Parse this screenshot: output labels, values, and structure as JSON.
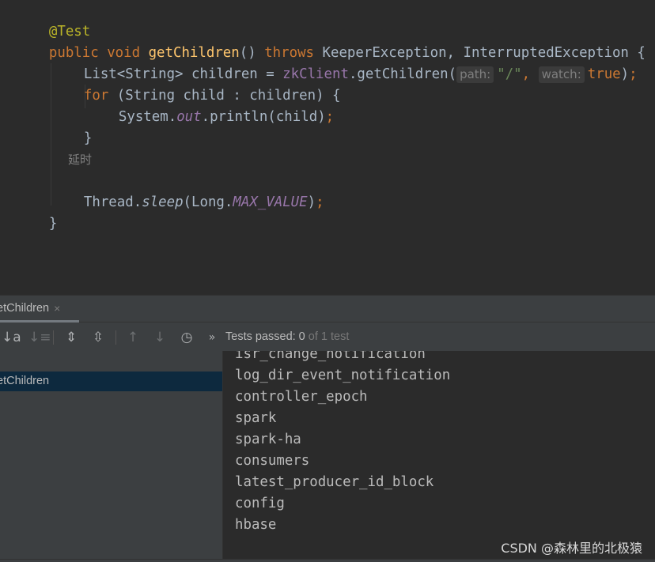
{
  "editor": {
    "annotation": "@Test",
    "sig_public": "public",
    "sig_void": "void",
    "method_name": "getChildren",
    "sig_parens": "()",
    "sig_throws": "throws",
    "sig_exceptions": "KeeperException, InterruptedException {",
    "list_decl": "List<String> children = ",
    "zk_client": "zkClient",
    "get_children_call": ".getChildren(",
    "hint_path": "path:",
    "path_value": "\"/\"",
    "arg_sep": ", ",
    "hint_watch": "watch:",
    "watch_value": "true",
    "close_paren": ")",
    "semicolon": ";",
    "for_kw": "for",
    "for_head": " (String child : children) {",
    "println_system": "System.",
    "println_out": "out",
    "println_call": ".println(child)",
    "close_brace_inner": "}",
    "inlay_comment": "延时",
    "thread": "Thread.",
    "sleep": "sleep",
    "long_open": "(Long.",
    "max_value": "MAX_VALUE",
    "close_brace_outer": "}"
  },
  "run_panel": {
    "tab_label": "etChildren",
    "tab_close": "×",
    "status_main": "Tests passed: 0",
    "status_sub": " of 1 test",
    "tree_item": "etChildren",
    "toolbar": {
      "sort_alpha": "↓a",
      "sort_duration": "↓≡",
      "expand_all": "⇕",
      "collapse_all": "⇳",
      "prev": "↑",
      "next": "↓",
      "history": "◷",
      "more": "»"
    },
    "console_lines": [
      "isr_change_notification",
      "log_dir_event_notification",
      "controller_epoch",
      "spark",
      "spark-ha",
      "consumers",
      "latest_producer_id_block",
      "config",
      "hbase"
    ]
  },
  "watermark": "CSDN @森林里的北极猿",
  "colors": {
    "editor_bg": "#2b2b2b",
    "panel_bg": "#3c3f41",
    "keyword": "#cc7832",
    "annotation": "#bbb529",
    "method": "#ffc66d",
    "field": "#9876aa",
    "string": "#6a8759",
    "text": "#a9b7c6",
    "selection": "#0d293e"
  }
}
